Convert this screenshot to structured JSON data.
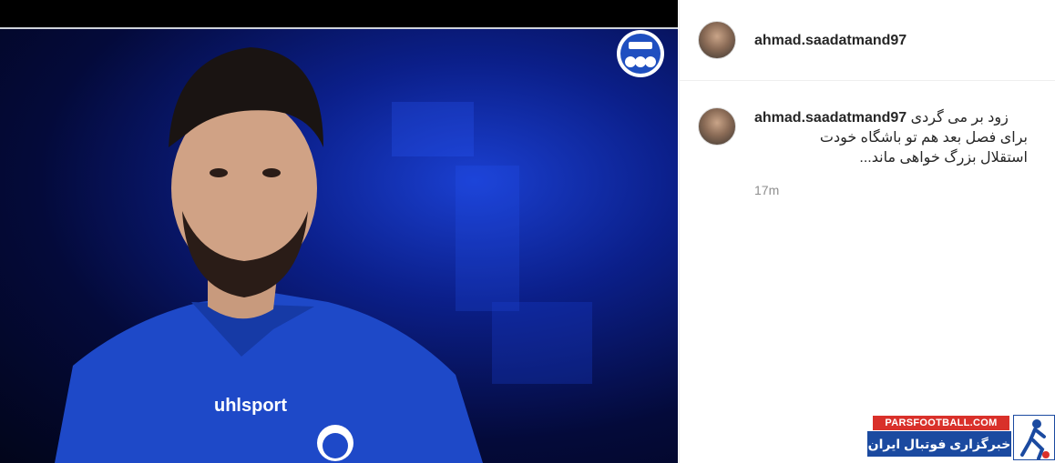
{
  "post": {
    "username": "ahmad.saadatmand97",
    "caption_user": "ahmad.saadatmand97",
    "caption_line1": "زود بر می گردی",
    "caption_line2": "برای فصل بعد هم تو باشگاه خودت",
    "caption_line3": "استقلال بزرگ خواهی ماند...",
    "time": "17m"
  },
  "photo": {
    "shirt_brand": "uhlsport"
  },
  "watermark": {
    "site": "PARSFOOTBALL.COM",
    "name": "خبرگزاری فوتبال ایران"
  },
  "colors": {
    "photo_blue": "#0b1f8a",
    "brand_red": "#d9302a",
    "brand_blue": "#1b4aa0"
  }
}
